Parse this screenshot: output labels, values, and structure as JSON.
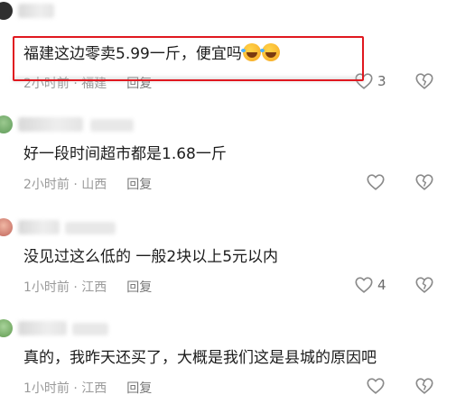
{
  "comments": [
    {
      "text": "福建这边零卖5.99一斤，便宜吗",
      "time": "2小时前",
      "location": "福建",
      "reply_label": "回复",
      "likes": "3",
      "avatar_color": "#3a3a3a",
      "reaction_icons": [
        "rofl-emoji-icon",
        "rofl-emoji-icon"
      ]
    },
    {
      "text": "好一段时间超市都是1.68一斤",
      "time": "2小时前",
      "location": "山西",
      "reply_label": "回复",
      "likes": "",
      "avatar_color": "#6fa66b"
    },
    {
      "text": "没见过这么低的 一般2块以上5元以内",
      "time": "1小时前",
      "location": "江西",
      "reply_label": "回复",
      "likes": "4",
      "avatar_color": "#d38a7a"
    },
    {
      "text": "真的，我昨天还买了，大概是我们这是县城的原因吧",
      "time": "1小时前",
      "location": "江西",
      "reply_label": "回复",
      "likes": "",
      "avatar_color": "#7fb36c"
    }
  ],
  "meta_separator": " · ",
  "highlight_color": "#e0181f"
}
